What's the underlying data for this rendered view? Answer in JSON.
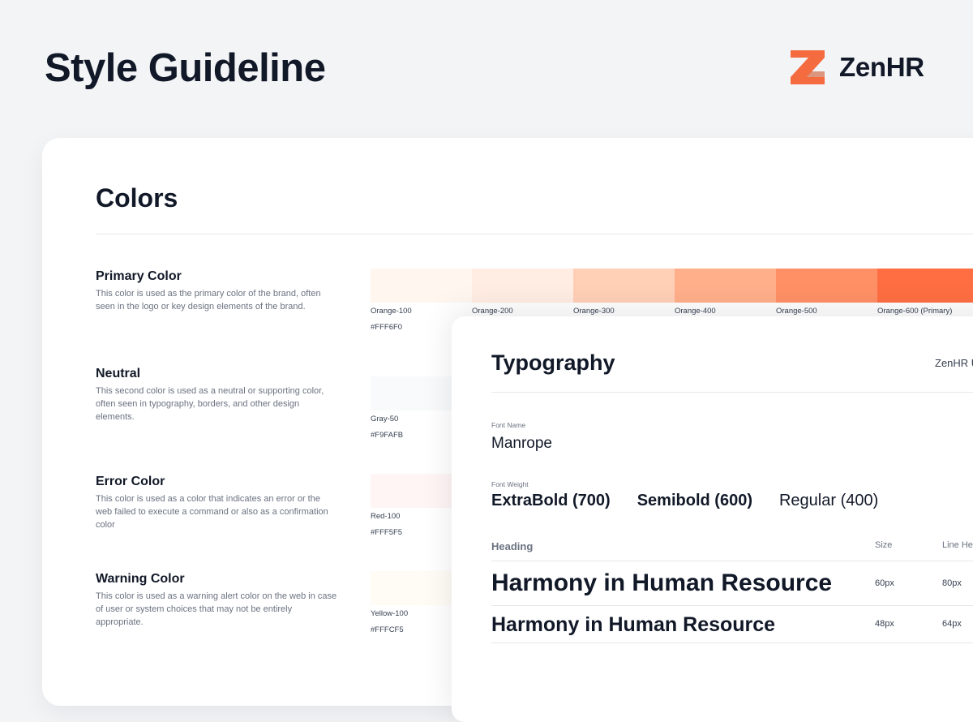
{
  "header": {
    "title": "Style Guideline",
    "brand_name": "ZenHR",
    "brand_color": "#F36B3F"
  },
  "colors_section": {
    "title": "Colors",
    "groups": [
      {
        "name": "Primary Color",
        "description": "This color is used as the primary color of the brand, often seen in the logo or key design elements of the brand.",
        "swatches": [
          {
            "name": "Orange-100",
            "hex_label": "#FFF6F0",
            "color": "#FFF6F0"
          },
          {
            "name": "Orange-200",
            "hex_label": "",
            "color": "#FFECE2"
          },
          {
            "name": "Orange-300",
            "hex_label": "",
            "color": "#FFCFB6"
          },
          {
            "name": "Orange-400",
            "hex_label": "",
            "color": "#FFAF8A"
          },
          {
            "name": "Orange-500",
            "hex_label": "",
            "color": "#FF9066"
          },
          {
            "name": "Orange-600 (Primary)",
            "hex_label": "",
            "color": "#FF6E43"
          }
        ]
      },
      {
        "name": "Neutral",
        "description": "This second color is used as a neutral or supporting color, often seen in typography, borders, and other design elements.",
        "swatches": [
          {
            "name": "Gray-50",
            "hex_label": "#F9FAFB",
            "color": "#F9FAFB"
          }
        ]
      },
      {
        "name": "Error Color",
        "description": "This color is used as a color that indicates an error or the web failed to execute a command or also as a confirmation color",
        "swatches": [
          {
            "name": "Red-100",
            "hex_label": "#FFF5F5",
            "color": "#FFF5F5"
          }
        ]
      },
      {
        "name": "Warning Color",
        "description": "This color is used as a warning alert color on the web in case of user or system choices that may not be entirely appropriate.",
        "swatches": [
          {
            "name": "Yellow-100",
            "hex_label": "#FFFCF5",
            "color": "#FFFCF5"
          }
        ]
      }
    ]
  },
  "typography": {
    "title": "Typography",
    "brand_label": "ZenHR U",
    "font_name_label": "Font Name",
    "font_name": "Manrope",
    "font_weight_label": "Font Weight",
    "weights": [
      "ExtraBold (700)",
      "Semibold (600)",
      "Regular (400)"
    ],
    "table": {
      "headers": {
        "heading": "Heading",
        "size": "Size",
        "line_height": "Line Heig"
      },
      "rows": [
        {
          "sample": "Harmony in Human Resource",
          "size": "60px",
          "line_height": "80px"
        },
        {
          "sample": "Harmony in Human Resource",
          "size": "48px",
          "line_height": "64px"
        }
      ]
    }
  }
}
